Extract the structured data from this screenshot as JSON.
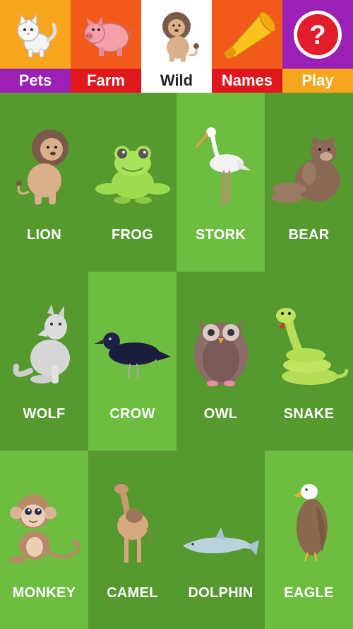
{
  "tabs": [
    {
      "id": "pets",
      "label": "Pets",
      "icon": "cat-icon",
      "top_color": "#f8a51e",
      "label_bg": "#9b20b5",
      "label_color": "#ffffff"
    },
    {
      "id": "farm",
      "label": "Farm",
      "icon": "pig-icon",
      "top_color": "#f25a1c",
      "label_bg": "#e1171e",
      "label_color": "#ffffff"
    },
    {
      "id": "wild",
      "label": "Wild",
      "icon": "lion-icon",
      "top_color": "#ffffff",
      "label_bg": "#ffffff",
      "label_color": "#222222",
      "selected": true
    },
    {
      "id": "names",
      "label": "Names",
      "icon": "megaphone-icon",
      "top_color": "#f25a1c",
      "label_bg": "#e1171e",
      "label_color": "#ffffff"
    },
    {
      "id": "play",
      "label": "Play",
      "icon": "question-icon",
      "top_color": "#9b20b5",
      "label_bg": "#f8a51e",
      "label_color": "#ffffff"
    }
  ],
  "animals": [
    {
      "name": "LION",
      "icon": "lion-icon",
      "shade": "dark"
    },
    {
      "name": "FROG",
      "icon": "frog-icon",
      "shade": "dark"
    },
    {
      "name": "STORK",
      "icon": "stork-icon",
      "shade": "light"
    },
    {
      "name": "BEAR",
      "icon": "bear-icon",
      "shade": "dark"
    },
    {
      "name": "WOLF",
      "icon": "wolf-icon",
      "shade": "dark"
    },
    {
      "name": "CROW",
      "icon": "crow-icon",
      "shade": "light"
    },
    {
      "name": "OWL",
      "icon": "owl-icon",
      "shade": "dark"
    },
    {
      "name": "SNAKE",
      "icon": "snake-icon",
      "shade": "dark"
    },
    {
      "name": "MONKEY",
      "icon": "monkey-icon",
      "shade": "light"
    },
    {
      "name": "CAMEL",
      "icon": "camel-icon",
      "shade": "dark"
    },
    {
      "name": "DOLPHIN",
      "icon": "dolphin-icon",
      "shade": "dark"
    },
    {
      "name": "EAGLE",
      "icon": "eagle-icon",
      "shade": "light"
    }
  ]
}
